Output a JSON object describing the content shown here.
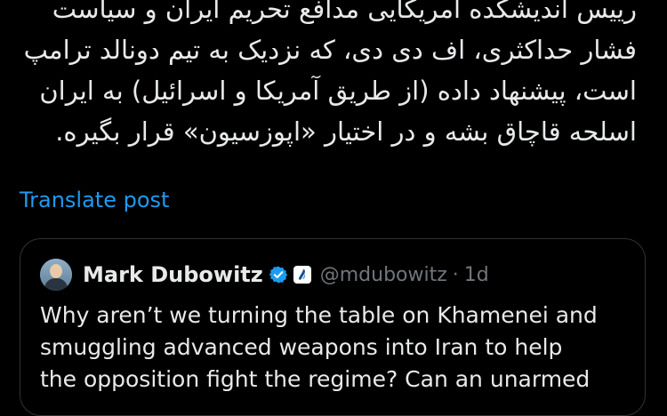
{
  "post": {
    "text_lines": [
      "رییس اندیشکده آمریکایی مدافع تحریم ایران و سیاست",
      "فشار حداکثری، اف دی دی، که نزدیک به تیم دونالد ترامپ",
      "است، پیشنهاد داده (از طریق آمریکا و اسرائیل) به ایران",
      "اسلحه قاچاق بشه و در اختیار «اپوزسیون» قرار بگیره."
    ],
    "translate_label": "Translate post"
  },
  "quote": {
    "author_name": "Mark Dubowitz",
    "handle": "@mdubowitz",
    "separator": "·",
    "time": "1d",
    "avatar_icon": "avatar-photo",
    "verified_icon": "verified-badge-icon",
    "affiliation_icon": "affiliate-badge-icon",
    "text_lines": [
      "Why aren’t we turning the table on Khamenei and",
      "smuggling advanced weapons into Iran to help",
      "the opposition fight the regime? Can an unarmed"
    ]
  },
  "colors": {
    "background": "#000000",
    "text": "#e7e9ea",
    "link": "#1d9bf0",
    "muted": "#71767b",
    "border": "#2f3336",
    "verified": "#1d9bf0"
  }
}
